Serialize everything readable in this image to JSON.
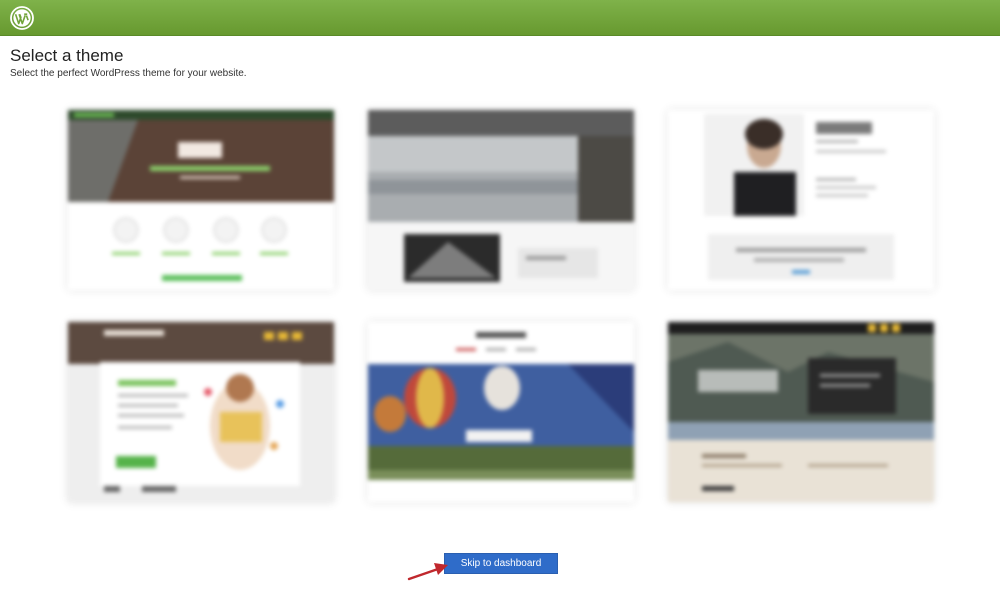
{
  "header": {
    "logo_icon": "wordpress-logo-icon",
    "bar_color": "#72a43b"
  },
  "main": {
    "title": "Select a theme",
    "subtitle": "Select the perfect WordPress theme for your website."
  },
  "themes": [
    {
      "id": "theme-1",
      "thumbnail": "theme-preview"
    },
    {
      "id": "theme-2",
      "thumbnail": "theme-preview"
    },
    {
      "id": "theme-3",
      "thumbnail": "theme-preview"
    },
    {
      "id": "theme-4",
      "thumbnail": "theme-preview"
    },
    {
      "id": "theme-5",
      "thumbnail": "theme-preview"
    },
    {
      "id": "theme-6",
      "thumbnail": "theme-preview"
    }
  ],
  "actions": {
    "skip_label": "Skip to dashboard",
    "button_color": "#2f6cc9"
  },
  "annotation": {
    "arrow_icon": "red-arrow-icon",
    "color": "#c0282d"
  }
}
